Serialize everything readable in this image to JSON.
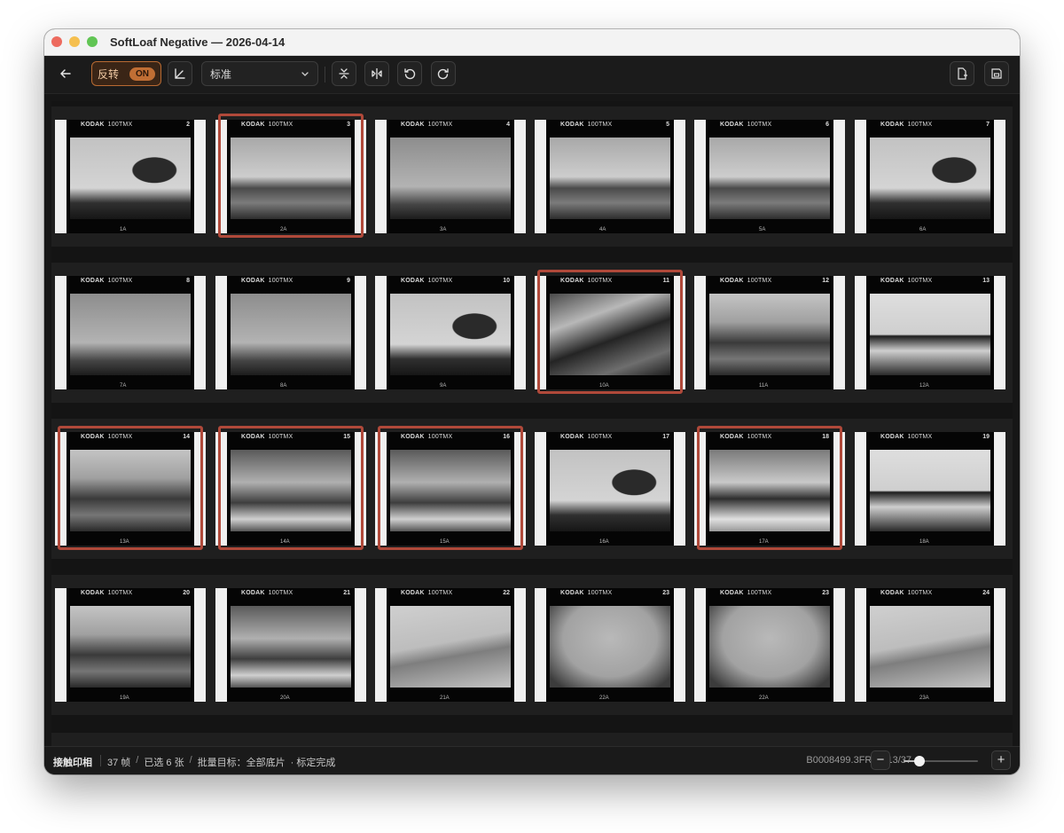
{
  "window": {
    "title": "SoftLoaf Negative — 2026-04-14"
  },
  "toolbar": {
    "invert_label": "反转",
    "invert_state": "ON",
    "preset_value": "标准",
    "icons": [
      "back-icon",
      "curve-icon",
      "chevron-down-icon",
      "flip-vertical-icon",
      "flip-horizontal-icon",
      "rotate-left-icon",
      "rotate-right-icon",
      "export-icon",
      "save-icon"
    ]
  },
  "film": {
    "brand": "KODAK",
    "stock": "100TMX",
    "rows": [
      [
        {
          "num": "2",
          "foot": "1A",
          "selected": false,
          "tone": "t-tree"
        },
        {
          "num": "3",
          "foot": "2A",
          "selected": true,
          "tone": "t-lake"
        },
        {
          "num": "4",
          "foot": "3A",
          "selected": false,
          "tone": "t-fog"
        },
        {
          "num": "5",
          "foot": "4A",
          "selected": false,
          "tone": "t-lake"
        },
        {
          "num": "6",
          "foot": "5A",
          "selected": false,
          "tone": "t-lake"
        },
        {
          "num": "7",
          "foot": "6A",
          "selected": false,
          "tone": "t-tree"
        }
      ],
      [
        {
          "num": "8",
          "foot": "7A",
          "selected": false,
          "tone": "t-fog"
        },
        {
          "num": "9",
          "foot": "8A",
          "selected": false,
          "tone": "t-fog"
        },
        {
          "num": "10",
          "foot": "9A",
          "selected": false,
          "tone": "t-tree"
        },
        {
          "num": "11",
          "foot": "10A",
          "selected": true,
          "tone": "t-sign"
        },
        {
          "num": "12",
          "foot": "11A",
          "selected": false,
          "tone": "t-ind"
        },
        {
          "num": "13",
          "foot": "12A",
          "selected": false,
          "tone": "t-struct"
        }
      ],
      [
        {
          "num": "14",
          "foot": "13A",
          "selected": true,
          "tone": "t-ind"
        },
        {
          "num": "15",
          "foot": "14A",
          "selected": true,
          "tone": "t-street"
        },
        {
          "num": "16",
          "foot": "15A",
          "selected": true,
          "tone": "t-street"
        },
        {
          "num": "17",
          "foot": "16A",
          "selected": false,
          "tone": "t-tree"
        },
        {
          "num": "18",
          "foot": "17A",
          "selected": true,
          "tone": "t-people"
        },
        {
          "num": "19",
          "foot": "18A",
          "selected": false,
          "tone": "t-struct"
        }
      ],
      [
        {
          "num": "20",
          "foot": "19A",
          "selected": false,
          "tone": "t-ind"
        },
        {
          "num": "21",
          "foot": "20A",
          "selected": false,
          "tone": "t-street"
        },
        {
          "num": "22",
          "foot": "21A",
          "selected": false,
          "tone": "t-wing"
        },
        {
          "num": "23",
          "foot": "22A",
          "selected": false,
          "tone": "t-snow"
        },
        {
          "num": "23",
          "foot": "22A",
          "selected": false,
          "tone": "t-snow"
        },
        {
          "num": "24",
          "foot": "23A",
          "selected": false,
          "tone": "t-wing"
        }
      ]
    ]
  },
  "status": {
    "mode": "接触印相",
    "count": "37 帧",
    "sep1": "/",
    "selected": "已选 6 张",
    "sep2": "/",
    "batch_target": "批量目标：全部底片",
    "calibration": "· 标定完成",
    "file": "B0008499.3FR — 13/37",
    "zoom_minus": "−",
    "zoom_plus": "+",
    "zoom_level": 0.22
  },
  "colors": {
    "accent": "#c06e34",
    "selection": "#b0493a"
  }
}
